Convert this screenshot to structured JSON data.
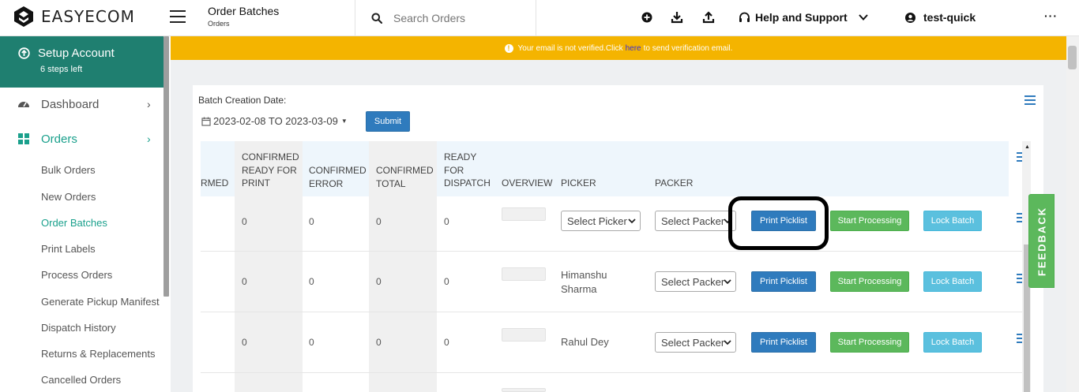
{
  "brand": {
    "name": "EASYECOM"
  },
  "header": {
    "title": "Order Batches",
    "breadcrumb": "Orders",
    "search_placeholder": "Search Orders",
    "help_label": "Help and Support",
    "username": "test-quick",
    "more_label": "···"
  },
  "sidebar": {
    "setup": {
      "title": "Setup Account",
      "subtitle": "6 steps left"
    },
    "main_items": [
      {
        "label": "Dashboard",
        "icon": "dashboard-icon"
      },
      {
        "label": "Orders",
        "icon": "grid-icon",
        "active": true
      }
    ],
    "order_subitems": [
      "Bulk Orders",
      "New Orders",
      "Order Batches",
      "Print Labels",
      "Process Orders",
      "Generate Pickup Manifest",
      "Dispatch History",
      "Returns & Replacements",
      "Cancelled Orders"
    ],
    "active_subitem": "Order Batches"
  },
  "banner": {
    "text_before": "Your email is not verified.Click",
    "link_text": "here",
    "text_after": "to send verification email.",
    "color": "#f4b400"
  },
  "filters": {
    "label": "Batch Creation Date:",
    "date_range": "2023-02-08 TO 2023-03-09",
    "submit_label": "Submit"
  },
  "table": {
    "columns": {
      "confirmed_partial": "RMED",
      "confirmed_ready_for_print": [
        "CONFIRMED",
        "READY FOR",
        "PRINT"
      ],
      "confirmed_error": [
        "CONFIRMED",
        "ERROR"
      ],
      "confirmed_total": [
        "CONFIRMED",
        "TOTAL"
      ],
      "ready_for_dispatch": [
        "READY",
        "FOR",
        "DISPATCH"
      ],
      "overview": "OVERVIEW",
      "picker": "PICKER",
      "packer": "PACKER"
    },
    "rows": [
      {
        "ready_for_print": "0",
        "error": "0",
        "total": "0",
        "ready_for_dispatch": "0",
        "picker": "Select Picker",
        "picker_is_select": true,
        "packer": "Select Packer",
        "print": "Print Picklist",
        "start": "Start Processing",
        "lock": "Lock Batch"
      },
      {
        "ready_for_print": "0",
        "error": "0",
        "total": "0",
        "ready_for_dispatch": "0",
        "picker": "Himanshu Sharma",
        "picker_line1": "Himanshu",
        "picker_line2": "Sharma",
        "picker_is_select": false,
        "packer": "Select Packer",
        "print": "Print Picklist",
        "start": "Start Processing",
        "lock": "Lock Batch"
      },
      {
        "ready_for_print": "0",
        "error": "0",
        "total": "0",
        "ready_for_dispatch": "0",
        "picker": "Rahul Dey",
        "picker_is_select": false,
        "packer": "Select Packer",
        "print": "Print Picklist",
        "start": "Start Processing",
        "lock": "Lock Batch"
      }
    ]
  },
  "feedback_label": "FEEDBACK",
  "colors": {
    "accent_teal": "#1f7f70",
    "primary_blue": "#2f7bbd",
    "success_green": "#5cb85c",
    "info_cyan": "#5bc0de"
  }
}
